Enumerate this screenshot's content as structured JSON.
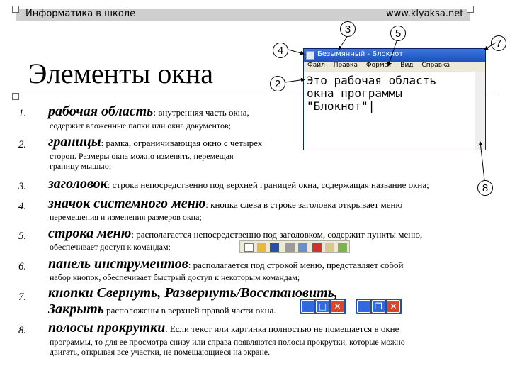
{
  "header": {
    "subject": "Информатика в школе",
    "site": "www.klyaksa.net"
  },
  "slide_title": "Элементы окна",
  "callouts": [
    "2",
    "3",
    "4",
    "5",
    "7",
    "8"
  ],
  "notepad": {
    "title": "Безымянный - Блокнот",
    "menu": [
      "Файл",
      "Правка",
      "Формат",
      "Вид",
      "Справка"
    ],
    "text": "Это рабочая область\nокна программы\n\"Блокнот\"|"
  },
  "items": [
    {
      "num": "1.",
      "term": "рабочая область",
      "desc": ": внутренняя часть окна,",
      "sub": "содержит вложенные папки или окна документов;"
    },
    {
      "num": "2.",
      "term": "границы",
      "desc": ": рамка, ограничивающая окно с четырех",
      "sub": "сторон. Размеры окна можно изменять, перемещая",
      "sub2": "границу мышью;"
    },
    {
      "num": "3.",
      "term": "заголовок",
      "desc": ": строка непосредственно под верхней границей окна, содержащая название окна;"
    },
    {
      "num": "4.",
      "term": "значок системного меню",
      "desc": ": кнопка слева в строке заголовка открывает меню",
      "sub": "перемещения и изменения размеров окна;"
    },
    {
      "num": "5.",
      "term": "строка меню",
      "desc": ": располагается непосредственно под заголовком, содержит пункты меню,",
      "sub": "обеспечивает доступ к командам;"
    },
    {
      "num": "6.",
      "term": "панель инструментов",
      "desc": ": располагается под строкой меню, представляет собой",
      "sub": "набор кнопок, обеспечивает быстрый доступ к некоторым командам;"
    },
    {
      "num": "7.",
      "term": "кнопки Свернуть, Развернуть/Восстановить,",
      "term2": "Закрыть",
      "desc": " расположены в верхней правой части окна."
    },
    {
      "num": "8.",
      "term": "полосы прокрутки",
      "desc": ". Если текст или картинка полностью не помещается в окне",
      "sub": "программы, то для ее просмотра снизу или справа появляются полосы прокрутки, которые можно",
      "sub2": "двигать, открывая все участки, не помещающиеся на экране."
    }
  ],
  "window_buttons": [
    "_",
    "□",
    "✕",
    "_",
    "❐",
    "✕"
  ],
  "colors": {
    "accent_blue": "#1c4fb8",
    "close_red": "#d9472b",
    "header_band": "#cfcfcf"
  }
}
